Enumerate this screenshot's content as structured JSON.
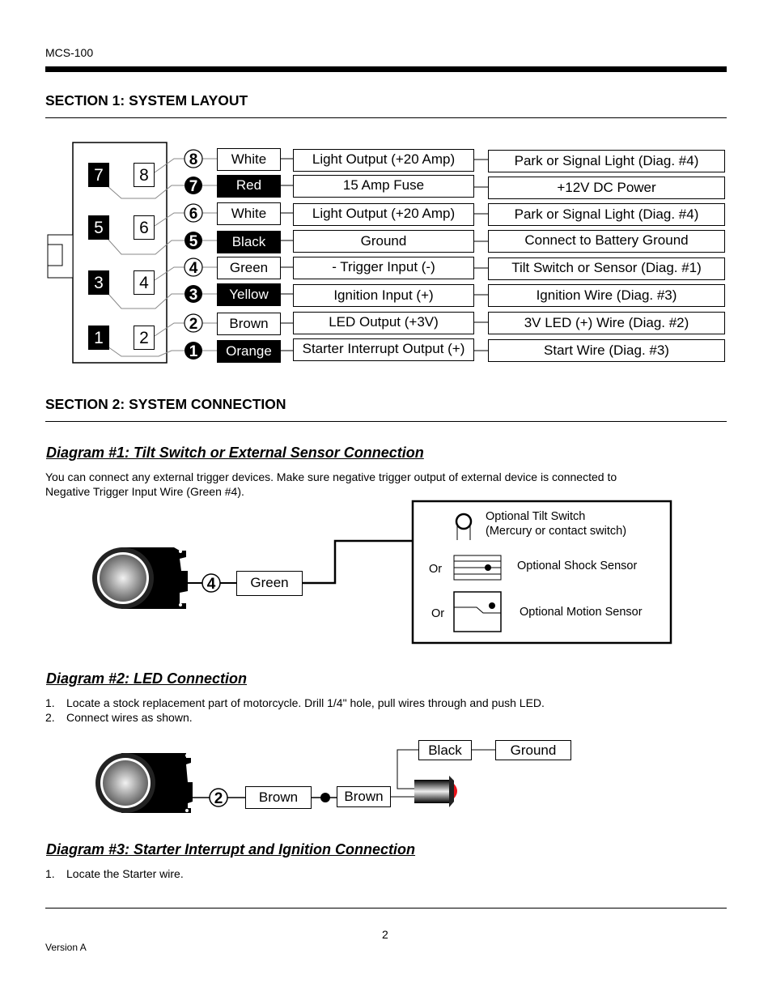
{
  "header": {
    "doc_id": "MCS-100"
  },
  "section1": {
    "title": "SECTION 1:  SYSTEM LAYOUT",
    "connector_pins": [
      "7",
      "8",
      "5",
      "6",
      "3",
      "4",
      "1",
      "2"
    ],
    "wires": [
      {
        "pin": "8",
        "color": "White",
        "dark": false,
        "function": "Light Output (+20 Amp)",
        "destination": "Park or Signal Light (Diag. #4)"
      },
      {
        "pin": "7",
        "color": "Red",
        "dark": true,
        "function": "15 Amp Fuse",
        "destination": "+12V DC Power"
      },
      {
        "pin": "6",
        "color": "White",
        "dark": false,
        "function": "Light Output (+20 Amp)",
        "destination": "Park or Signal Light (Diag. #4)"
      },
      {
        "pin": "5",
        "color": "Black",
        "dark": true,
        "function": "Ground",
        "destination": "Connect to Battery Ground"
      },
      {
        "pin": "4",
        "color": "Green",
        "dark": false,
        "function": "- Trigger Input (-)",
        "destination": "Tilt Switch or Sensor (Diag. #1)"
      },
      {
        "pin": "3",
        "color": "Yellow",
        "dark": true,
        "function": "Ignition Input (+)",
        "destination": "Ignition Wire (Diag. #3)"
      },
      {
        "pin": "2",
        "color": "Brown",
        "dark": false,
        "function": "LED Output (+3V)",
        "destination": "3V LED (+) Wire (Diag. #2)"
      },
      {
        "pin": "1",
        "color": "Orange",
        "dark": true,
        "function": "Starter Interrupt Output (+)",
        "destination": "Start Wire (Diag. #3)"
      }
    ]
  },
  "section2": {
    "title": "SECTION 2:  SYSTEM CONNECTION",
    "diagram1": {
      "title": "Diagram #1:  Tilt Switch or External Sensor Connection",
      "description": "You can connect any external trigger devices.  Make sure negative trigger output of external device is connected to Negative Trigger Input Wire (Green #4).",
      "desc_line1": "You can connect any external trigger devices.  Make sure negative trigger output of external device is connected to",
      "desc_line2": "Negative Trigger Input Wire (Green #4).",
      "pin": "4",
      "wire_label": "Green",
      "options": [
        {
          "line1": "Optional Tilt Switch",
          "line2": "(Mercury or contact switch)",
          "prefix": ""
        },
        {
          "line1": "Optional Shock Sensor",
          "prefix": "Or"
        },
        {
          "line1": "Optional Motion Sensor",
          "prefix": "Or"
        }
      ]
    },
    "diagram2": {
      "title": "Diagram #2:  LED Connection",
      "steps": [
        {
          "num": "1.",
          "text": "Locate a stock replacement part of motorcycle.  Drill 1/4\" hole, pull wires through and push LED."
        },
        {
          "num": "2.",
          "text": "Connect wires as shown."
        }
      ],
      "pin": "2",
      "wire_label": "Brown",
      "led_wire_label": "Brown",
      "led_ground_wire": "Black",
      "ground_label": "Ground",
      "led_color": "#e8141b"
    },
    "diagram3": {
      "title": "Diagram #3:  Starter Interrupt and Ignition Connection",
      "steps": [
        {
          "num": "1.",
          "text": "Locate the Starter wire."
        }
      ]
    }
  },
  "footer": {
    "page_number": "2",
    "version": "Version A"
  }
}
